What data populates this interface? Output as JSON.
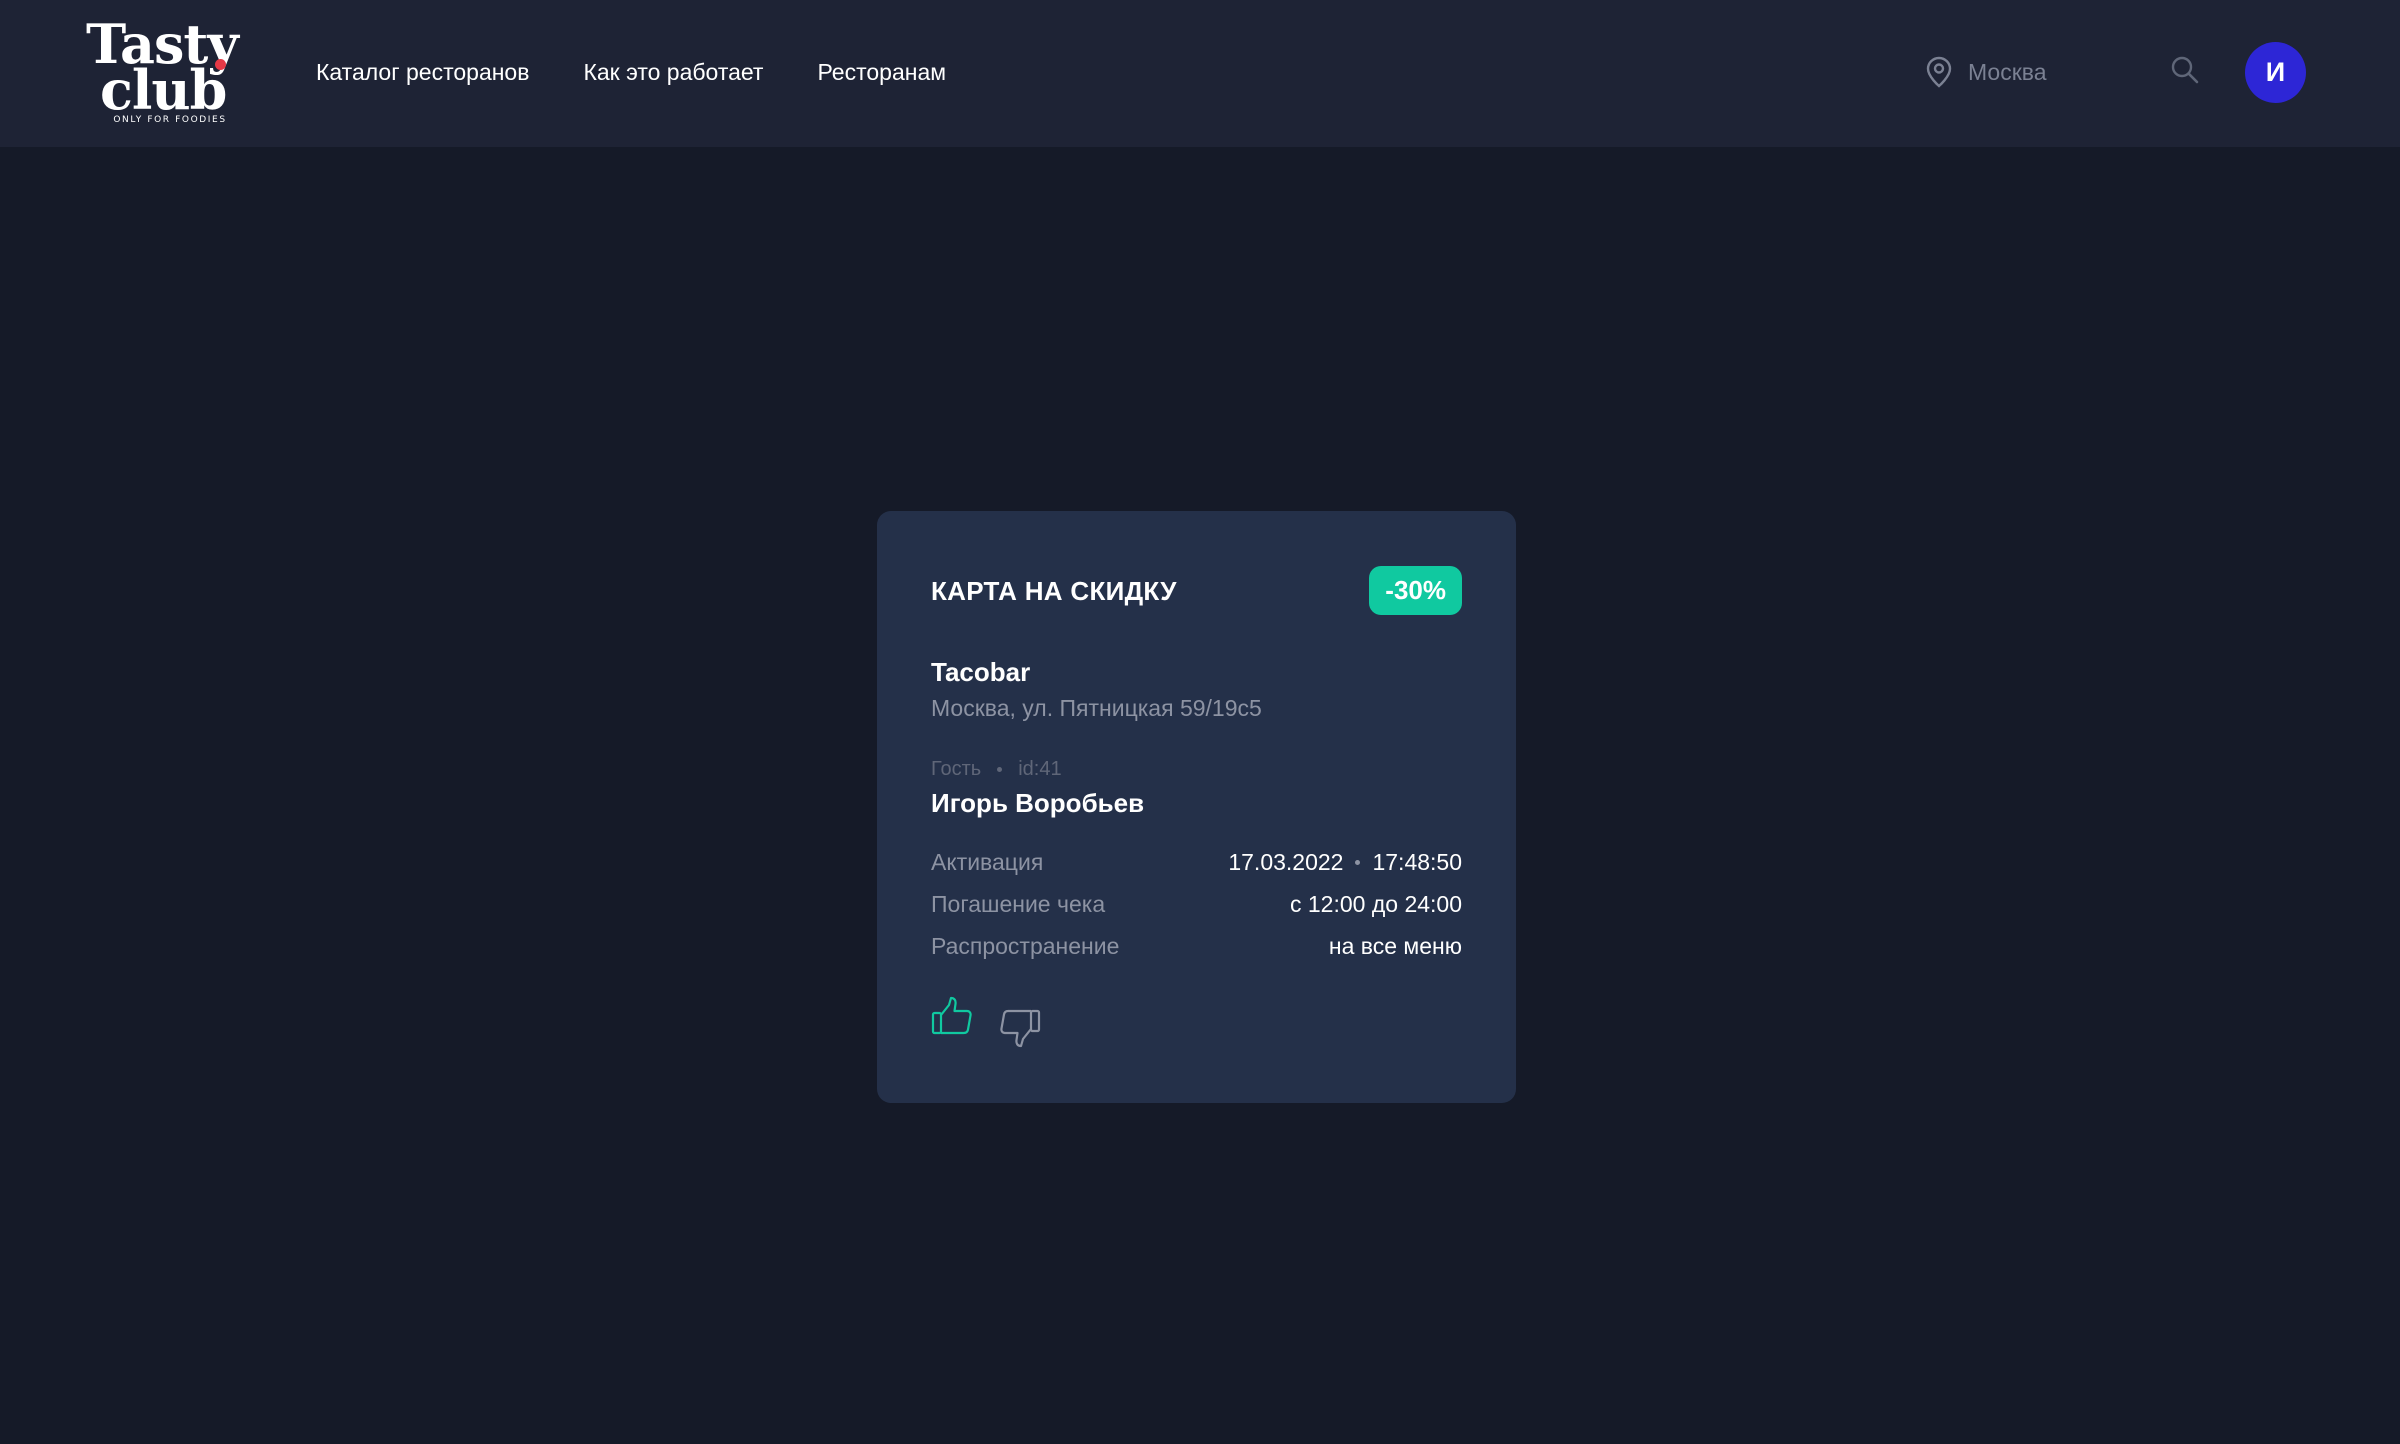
{
  "colors": {
    "page_bg": "#151a28",
    "header_bg": "#1e2335",
    "card_bg": "#243049",
    "accent": "#10c9a0",
    "avatar_bg": "#2d26d6",
    "logo_dot": "#e63946",
    "muted_text": "#8d93a3"
  },
  "header": {
    "logo": {
      "line1": "Tasty",
      "line2": "club",
      "tagline": "ONLY FOR FOODIES"
    },
    "nav": [
      {
        "label": "Каталог ресторанов"
      },
      {
        "label": "Как это работает"
      },
      {
        "label": "Ресторанам"
      }
    ],
    "location": {
      "icon": "map-pin-icon",
      "city": "Москва"
    },
    "search_icon": "search-icon",
    "avatar": {
      "initial": "И"
    }
  },
  "card": {
    "title": "КАРТА НА СКИДКУ",
    "discount": "-30%",
    "restaurant": {
      "name": "Tacobar",
      "address": "Москва, ул. Пятницкая 59/19с5"
    },
    "guest": {
      "label": "Гость",
      "id": "id:41",
      "name": "Игорь Воробьев"
    },
    "details": {
      "activation": {
        "label": "Активация",
        "date": "17.03.2022",
        "time": "17:48:50"
      },
      "redemption": {
        "label": "Погашение чека",
        "value": "с 12:00 до 24:00"
      },
      "scope": {
        "label": "Распространение",
        "value": "на все меню"
      }
    },
    "votes": {
      "like_icon": "thumbs-up-icon",
      "dislike_icon": "thumbs-down-icon"
    }
  }
}
